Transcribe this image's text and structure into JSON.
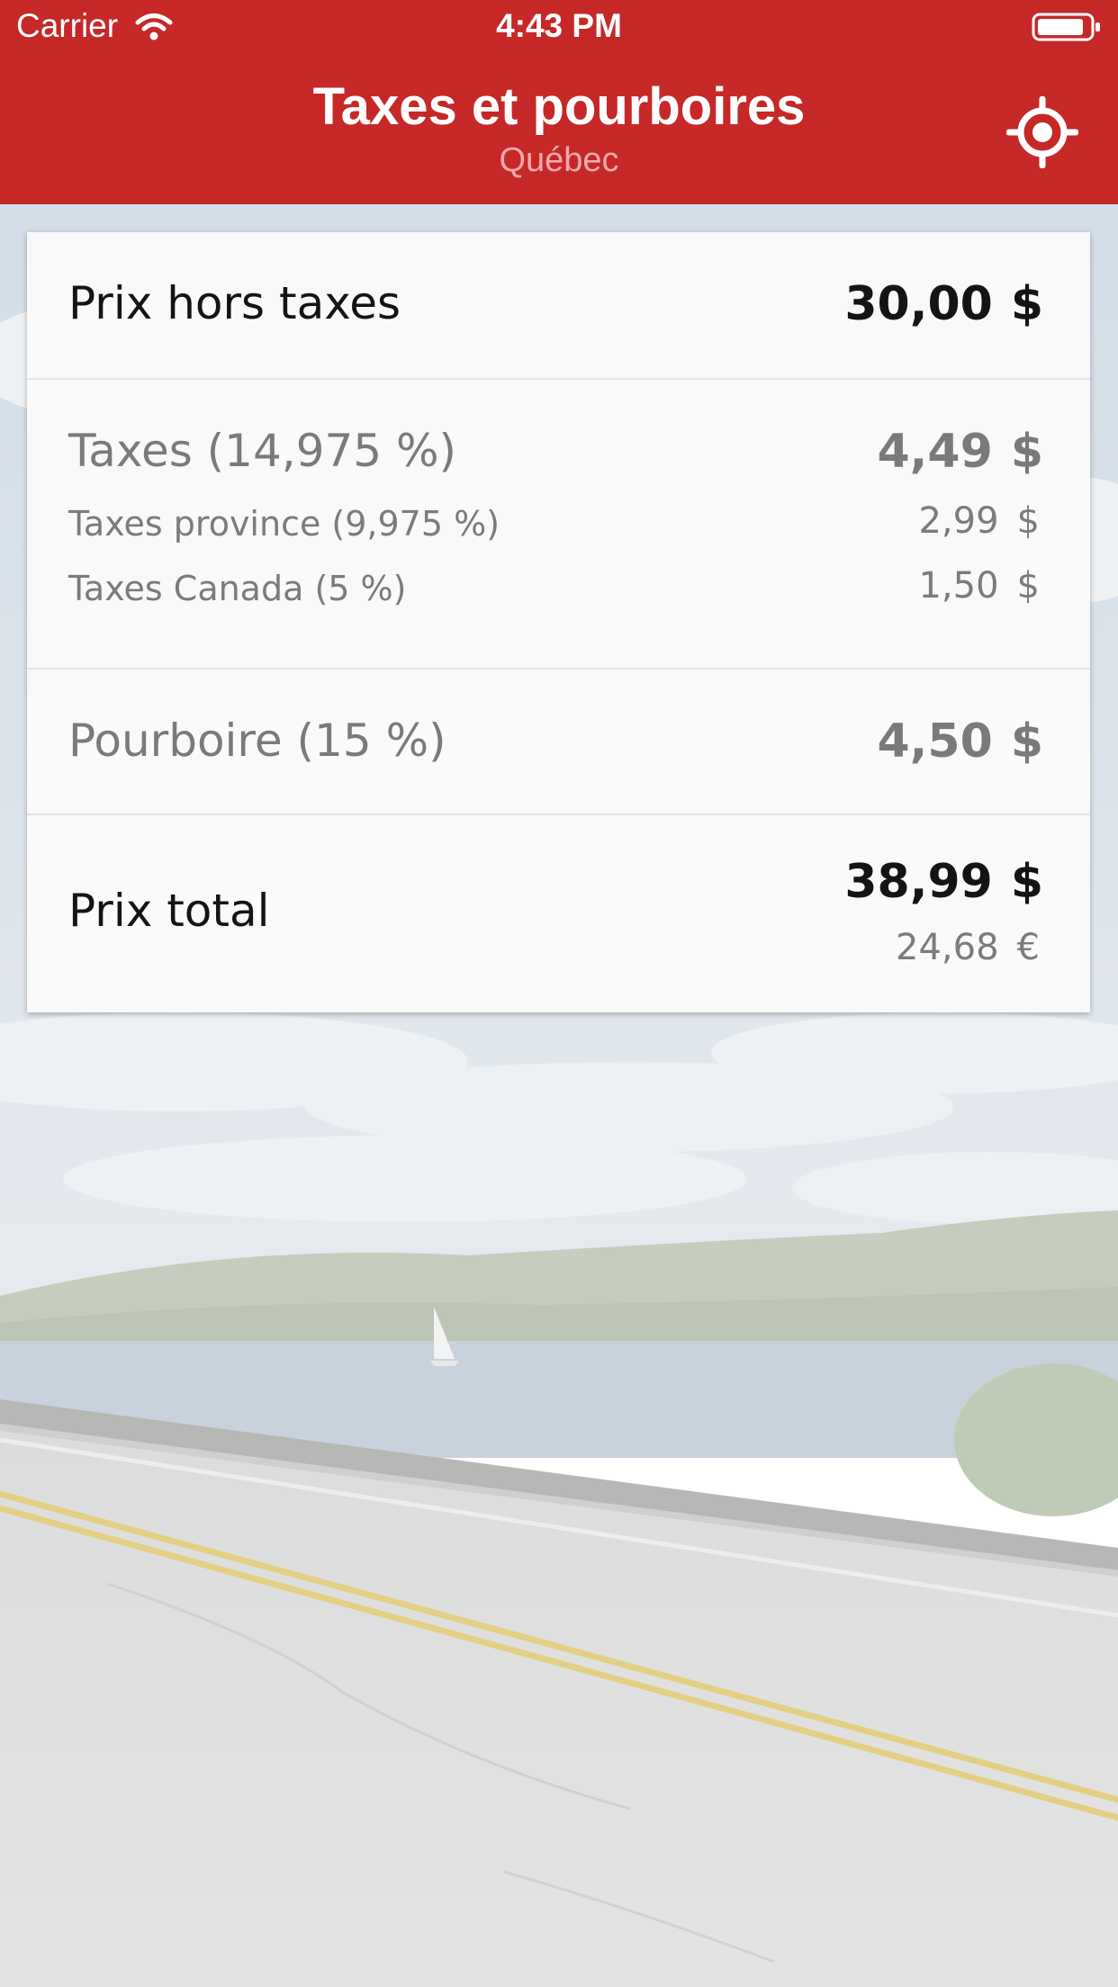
{
  "status_bar": {
    "carrier": "Carrier",
    "time": "4:43 PM",
    "wifi_icon": "wifi-icon",
    "battery_icon": "battery-icon"
  },
  "header": {
    "title": "Taxes et pourboires",
    "subtitle": "Québec",
    "locate_icon": "crosshair-location-icon"
  },
  "card": {
    "price_before_tax": {
      "label": "Prix hors taxes",
      "amount": "30,00",
      "currency": "$"
    },
    "taxes": {
      "label": "Taxes (14,975 %)",
      "amount": "4,49",
      "currency": "$",
      "breakdown": [
        {
          "label": "Taxes province (9,975 %)",
          "amount": "2,99",
          "currency": "$"
        },
        {
          "label": "Taxes Canada (5 %)",
          "amount": "1,50",
          "currency": "$"
        }
      ]
    },
    "tip": {
      "label": "Pourboire (15 %)",
      "amount": "4,50",
      "currency": "$"
    },
    "total": {
      "label": "Prix total",
      "amount": "38,99",
      "currency": "$",
      "converted_amount": "24,68",
      "converted_currency": "€"
    }
  },
  "colors": {
    "header_background": "#c62828",
    "subtitle": "#f2a9a9",
    "primary_text": "#141414",
    "secondary_text": "#7a7a7a",
    "card_background": "#fafafa"
  }
}
